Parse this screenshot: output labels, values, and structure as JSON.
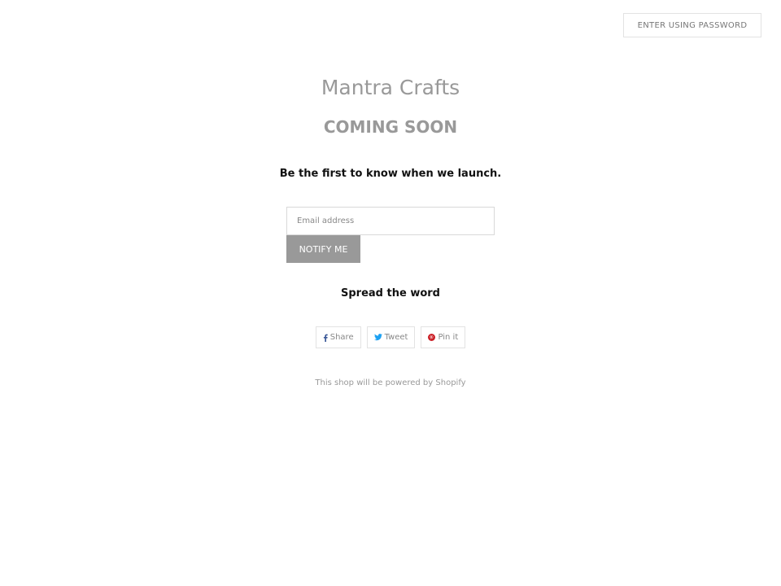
{
  "header": {
    "password_button_label": "ENTER USING PASSWORD"
  },
  "main": {
    "shop_name": "Mantra Crafts",
    "headline": "COMING SOON",
    "subtext": "Be the first to know when we launch.",
    "signup": {
      "email_placeholder": "Email address",
      "email_value": "",
      "submit_label": "NOTIFY ME"
    },
    "share": {
      "title": "Spread the word",
      "buttons": [
        {
          "label": "Share",
          "icon": "facebook-icon",
          "color": "#3b5998"
        },
        {
          "label": "Tweet",
          "icon": "twitter-icon",
          "color": "#1da1f2"
        },
        {
          "label": "Pin it",
          "icon": "pinterest-icon",
          "color": "#cb2027"
        }
      ]
    }
  },
  "footer": {
    "text_prefix": "This shop will be powered by ",
    "link_text": "Shopify"
  }
}
